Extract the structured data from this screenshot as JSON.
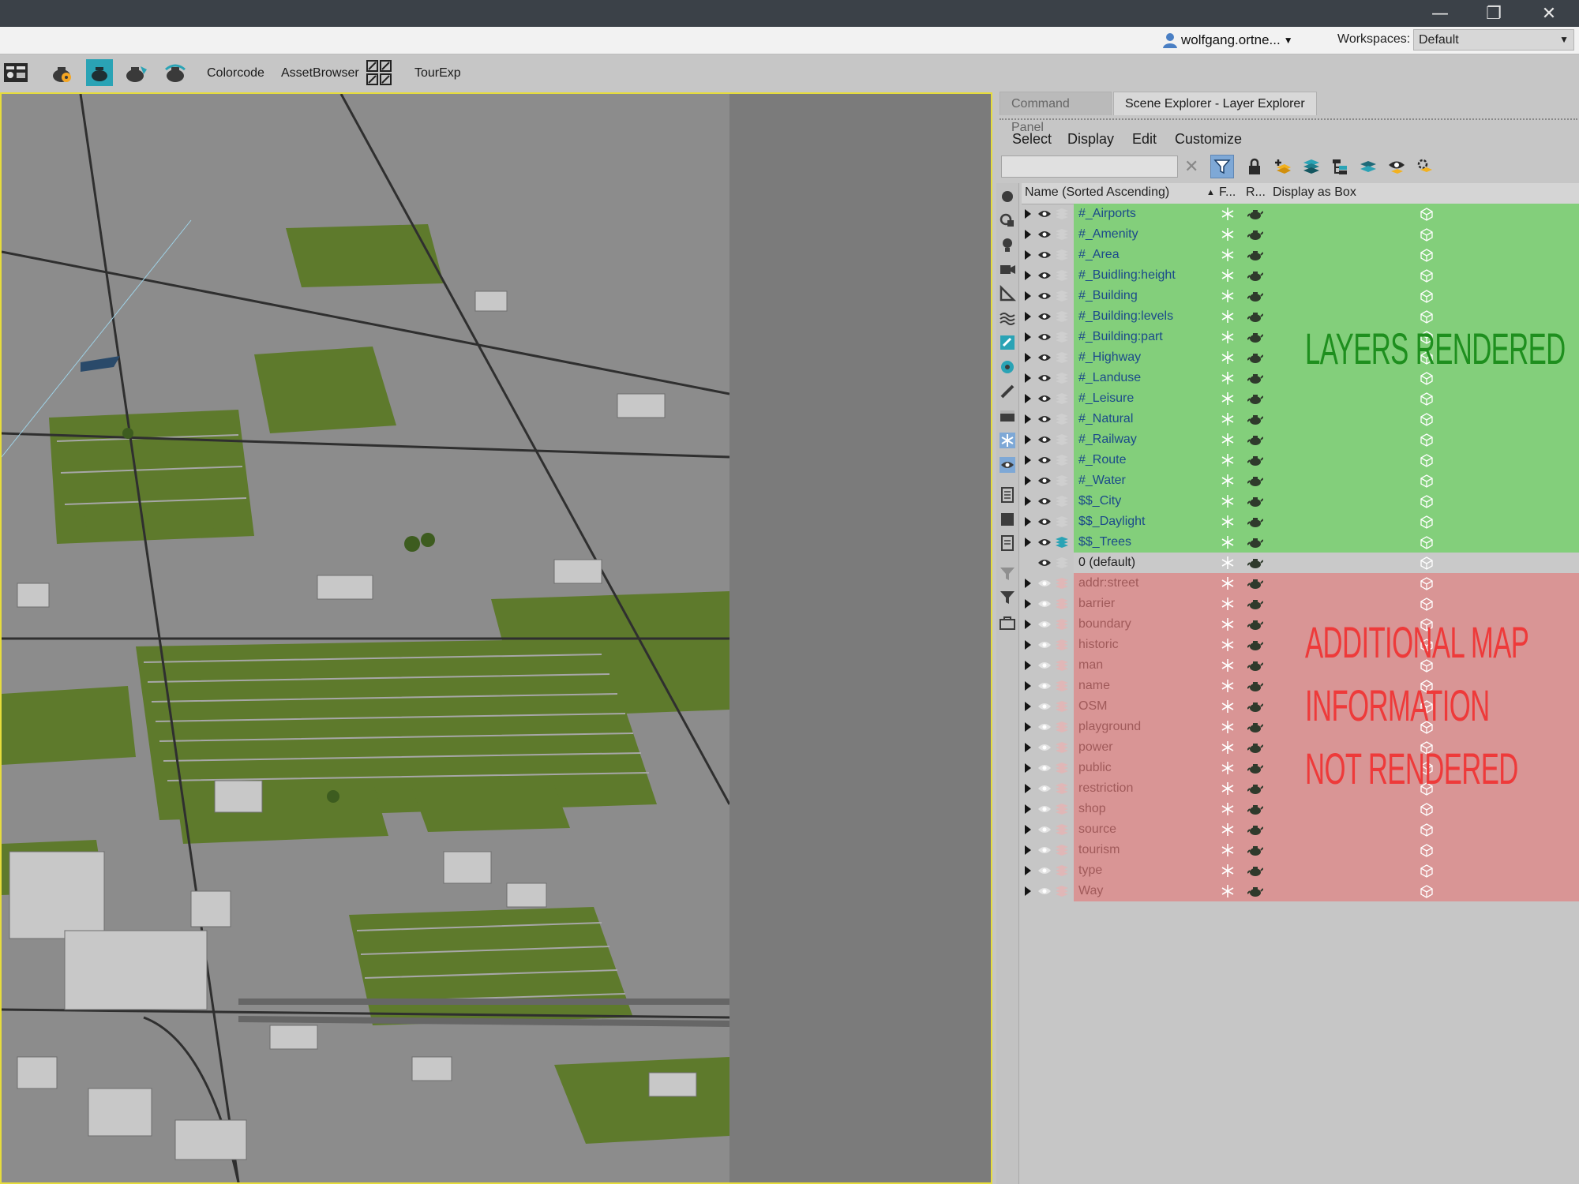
{
  "window": {
    "minimize": "—",
    "restore": "❐",
    "close": "✕"
  },
  "account": {
    "user": "wolfgang.ortne...",
    "workspaces_label": "Workspaces:",
    "workspace": "Default"
  },
  "toolbar": {
    "colorcode": "Colorcode",
    "asset_browser": "AssetBrowser",
    "tourexp": "TourExp"
  },
  "panel": {
    "tabs": [
      "Command Panel",
      "Scene Explorer - Layer Explorer"
    ],
    "menu": [
      "Select",
      "Display",
      "Edit",
      "Customize"
    ],
    "search_value": "",
    "columns": {
      "name": "Name (Sorted Ascending)",
      "freeze": "F...",
      "render": "R...",
      "box": "Display as Box"
    }
  },
  "layers_rendered": [
    "#_Airports",
    "#_Amenity",
    "#_Area",
    "#_Buidling:height",
    "#_Building",
    "#_Building:levels",
    "#_Building:part",
    "#_Highway",
    "#_Landuse",
    "#_Leisure",
    "#_Natural",
    "#_Railway",
    "#_Route",
    "#_Water",
    "$$_City",
    "$$_Daylight",
    "$$_Trees"
  ],
  "default_layer": "0 (default)",
  "layers_not_rendered": [
    "addr:street",
    "barrier",
    "boundary",
    "historic",
    "man",
    "name",
    "OSM",
    "playground",
    "power",
    "public",
    "restriction",
    "shop",
    "source",
    "tourism",
    "type",
    "Way"
  ],
  "annotations": {
    "rendered": "LAYERS RENDERED",
    "not_rendered": [
      "ADDITIONAL MAP",
      "INFORMATION",
      "NOT RENDERED"
    ]
  },
  "colors": {
    "rendered_band": "#83cf7b",
    "not_rendered_band": "#d99595",
    "viewport_border": "#e6dc3c"
  },
  "icons": [
    "user-icon",
    "snowflake-icon",
    "teapot-icon",
    "box-icon",
    "eye-icon",
    "layer-stack-icon",
    "lock-icon",
    "filter-icon"
  ]
}
